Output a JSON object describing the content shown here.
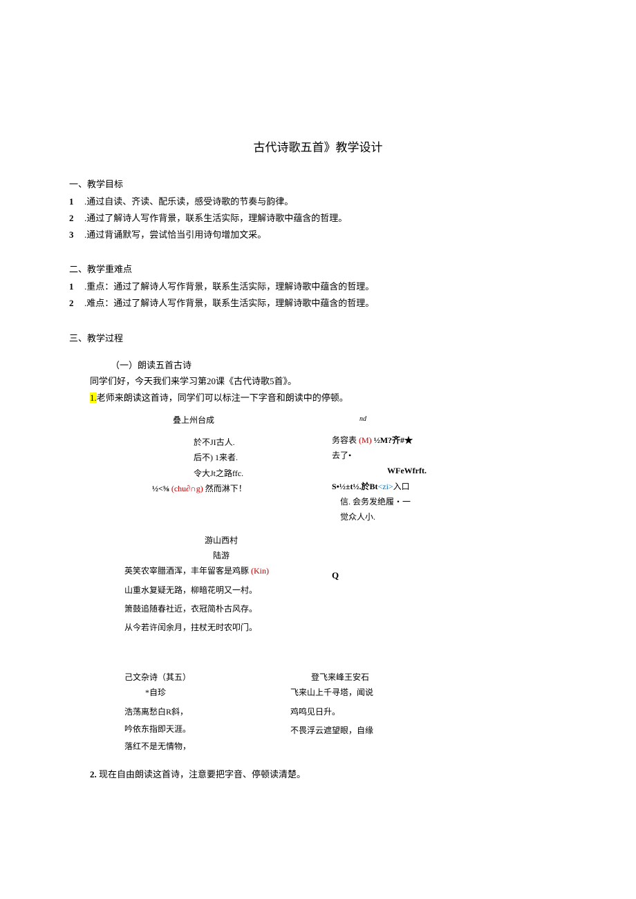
{
  "title": "古代诗歌五首》教学设计",
  "sections": {
    "s1": {
      "heading": "一、教学目标",
      "items": [
        {
          "num": "1",
          "text": ".通过自读、齐读、配乐读，感受诗歌的节奏与韵律。"
        },
        {
          "num": "2",
          "text": ".通过了解诗人写作背景，联系生活实际，理解诗歌中蕴含的哲理。"
        },
        {
          "num": "3",
          "text": ".通过背诵默写，尝试恰当引用诗句增加文采。"
        }
      ]
    },
    "s2": {
      "heading": "二、教学重难点",
      "items": [
        {
          "num": "1",
          "text": ".重点：通过了解诗人写作背景，联系生活实际，理解诗歌中蕴含的哲理。"
        },
        {
          "num": "2",
          "text": ".难点：通过了解诗人写作背景，联系生活实际，理解诗歌中蕴含的哲理。"
        }
      ]
    },
    "s3": {
      "heading": "三、教学过程",
      "sub": "（一）朗读五首古诗",
      "p1": "同学们好，今天我们来学习第20课《古代诗歌5首》。",
      "p2_num": "1.",
      "p2_text": "老师来朗读这首诗，同学们可以标注一下字音和朗读中的停顿。"
    }
  },
  "poem_a": {
    "title": "叠上州台成",
    "lines": [
      "於不JI古人.",
      "后不) 1来者.",
      "令大Jt之路ffc."
    ],
    "last_prefix": "½<⅝ ",
    "last_red": "(chu∂∩g)",
    "last_suffix": " 然而淋下！"
  },
  "poem_b": {
    "nd": "nd",
    "line1_a": "务容表 ",
    "line1_red": "(M)",
    "line1_b": "  ½M?齐#★",
    "line2": "去了•",
    "line3": "WFeWfrft.",
    "line4_a": "S•½±t½.於Bt",
    "line4_blue": "<zi>",
    "line4_b": "入口",
    "line5": "信. 会务发绝履・一",
    "line6": "觉众人小."
  },
  "poem_c": {
    "title": "游山西村",
    "author": "陆游",
    "line1_a": "英笑农宰腊酒浑，丰年留客是鸡豚 ",
    "line1_red": "(Kin)",
    "line2": "山重水复疑无路，柳暗花明又一村。",
    "line3": "箫鼓追随春社近，衣冠简朴古风存。",
    "line4": "从今若许闰余月，拄杖无时农叩门。",
    "q": "Q"
  },
  "poem_d": {
    "title": "己文杂诗（其五）",
    "author": "*自珍",
    "lines": [
      "浩荡离愁白R斜，",
      "吟依东指即天涯。",
      "落红不是无情物，"
    ]
  },
  "poem_e": {
    "title": "登飞来峰王安石",
    "line1": "飞来山上千寻塔，闻说",
    "line2": "鸡鸣见日升。",
    "line3": "不畏浮云遮望眼，自缘"
  },
  "footnote": {
    "num": "2. ",
    "text": "现在自由朗读这首诗，注意要把字音、停顿读清楚。"
  }
}
